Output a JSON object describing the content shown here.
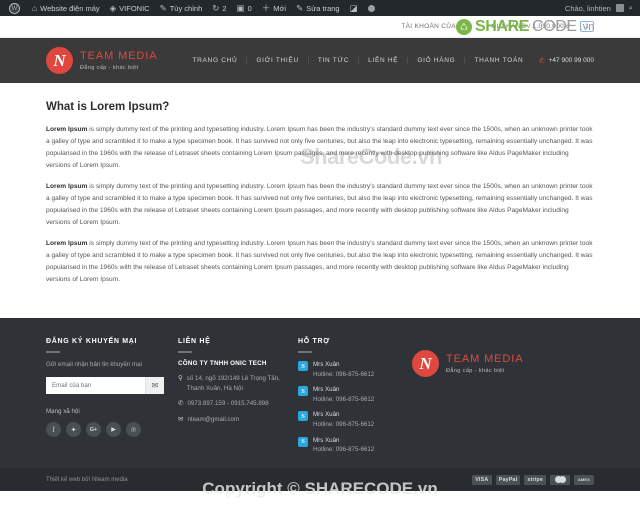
{
  "adminbar": {
    "items": [
      {
        "icon": "wordpress-logo-icon",
        "label": ""
      },
      {
        "icon": "site-icon",
        "label": "Website điện máy"
      },
      {
        "icon": "vifonic-icon",
        "label": "VIFONIC"
      },
      {
        "icon": "pencil-icon",
        "label": "Tùy chỉnh"
      },
      {
        "icon": "updates-icon",
        "label": "2"
      },
      {
        "icon": "comment-icon",
        "label": "0"
      },
      {
        "icon": "plus-icon",
        "label": "Mới"
      },
      {
        "icon": "edit-icon",
        "label": "Sửa trang"
      },
      {
        "icon": "plugin-icon",
        "label": ""
      },
      {
        "icon": "dot-icon",
        "label": ""
      }
    ],
    "greeting": "Chào, linhtien",
    "search_icon": "search-icon"
  },
  "topbar": {
    "account": "TÀI KHOẢN CỦA TÔI",
    "cart": "GIỎ HÀNG / 1.090.000 đ",
    "cart_count": "1"
  },
  "header": {
    "logo_letter": "N",
    "brand_name": "TEAM MEDIA",
    "brand_tagline": "Đẳng cấp - khác biệt",
    "nav": [
      {
        "label": "TRANG CHỦ"
      },
      {
        "label": "GIỚI THIỆU"
      },
      {
        "label": "TIN TỨC"
      },
      {
        "label": "LIÊN HỆ"
      },
      {
        "label": "GIỎ HÀNG"
      },
      {
        "label": "THANH TOÁN"
      }
    ],
    "phone_icon": "phone-icon",
    "phone": "+47 900 99 000"
  },
  "content": {
    "title": "What is Lorem Ipsum?",
    "lead": "Lorem Ipsum",
    "body": " is simply dummy text of the printing and typesetting industry. Lorem Ipsum has been the industry's standard dummy text ever since the 1500s, when an unknown printer took a galley of type and scrambled it to make a type specimen book. It has survived not only five centuries, but also the leap into electronic typesetting, remaining essentially unchanged. It was popularised in the 1960s with the release of Letraset sheets containing Lorem Ipsum passages, and more recently with desktop publishing software like Aldus PageMaker including versions of Lorem Ipsum."
  },
  "footer": {
    "subscribe": {
      "heading": "ĐĂNG KÝ KHUYẾN MẠI",
      "subtitle": "Gửi email nhận bản tin khuyến mại",
      "placeholder": "Email của bạn",
      "value": "",
      "button_icon": "envelope-icon"
    },
    "social": {
      "title": "Mạng xã hội",
      "items": [
        {
          "name": "facebook-icon",
          "glyph": "f"
        },
        {
          "name": "twitter-icon",
          "glyph": "✦"
        },
        {
          "name": "google-plus-icon",
          "glyph": "G+"
        },
        {
          "name": "youtube-icon",
          "glyph": "▶"
        },
        {
          "name": "pinterest-icon",
          "glyph": "℗"
        }
      ]
    },
    "contact": {
      "heading": "LIÊN HỆ",
      "company": "CÔNG TY TNHH ONIC TECH",
      "address_icon": "location-pin-icon",
      "address": "số 14, ngõ 192/149 Lê Trọng Tấn, Thanh Xuân, Hà Nội",
      "phone_icon": "phone-icon",
      "phone": "0973.897.159 - 0915.745.898",
      "email_icon": "envelope-icon",
      "email": "nteam@gmail.com"
    },
    "support": {
      "heading": "HỖ TRỢ",
      "items": [
        {
          "icon": "skype-icon",
          "name": "Mrs Xuân",
          "hotline": "Hotline: 096-875-6612"
        },
        {
          "icon": "skype-icon",
          "name": "Mrs Xuân",
          "hotline": "Hotline: 096-875-6612"
        },
        {
          "icon": "skype-icon",
          "name": "Mrs Xuân",
          "hotline": "Hotline: 096-875-6612"
        },
        {
          "icon": "skype-icon",
          "name": "Mrs Xuân",
          "hotline": "Hotline: 096-875-6612"
        }
      ]
    },
    "brand": {
      "logo_letter": "N",
      "name": "TEAM MEDIA",
      "tagline": "Đẳng cấp - khác biệt"
    }
  },
  "bottombar": {
    "credit": "Thiết kế web bởi Nteam media",
    "payments": [
      {
        "name": "visa-icon",
        "label": "VISA"
      },
      {
        "name": "paypal-icon",
        "label": "PayPal"
      },
      {
        "name": "stripe-icon",
        "label": "stripe"
      },
      {
        "name": "mastercard-icon",
        "label": ""
      },
      {
        "name": "amex-icon",
        "label": "AMEX"
      }
    ]
  },
  "watermark": {
    "share": "SHARE",
    "code": "CODE",
    "vn": ".vn",
    "middle": "ShareCode.vn",
    "bottom": "Copyright © SHARECODE.vn"
  },
  "colors": {
    "brand_red": "#e0483f",
    "header_dark": "#3a3a3a",
    "footer_dark": "#2f3337",
    "bottom_dark": "#282c2f",
    "skype_blue": "#29a8e0",
    "watermark_green": "#7ab648"
  }
}
